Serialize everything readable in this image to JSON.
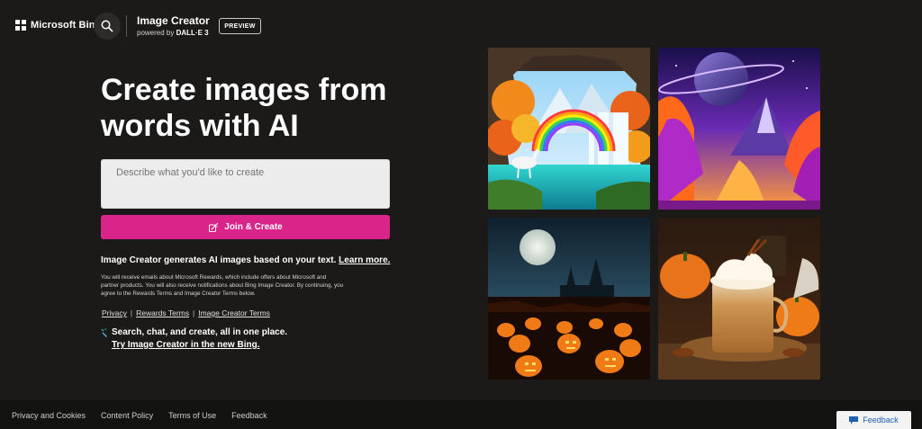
{
  "header": {
    "brand": "Microsoft Bing",
    "app_title": "Image Creator",
    "powered_prefix": "powered by",
    "powered_model": "DALL·E 3",
    "badge": "PREVIEW"
  },
  "hero": {
    "title": "Create images from words with AI",
    "prompt_placeholder": "Describe what you'd like to create",
    "join_button": "Join & Create",
    "info_text": "Image Creator generates AI images based on your text.",
    "info_link": "Learn more.",
    "fine_print": "You will receive emails about Microsoft Rewards, which include offers about Microsoft and partner products. You will also receive notifications about Bing Image Creator. By continuing, you agree to the Rewards Terms and Image Creator Terms below.",
    "legal_links": [
      "Privacy",
      "Rewards Terms",
      "Image Creator Terms"
    ],
    "legal_separator": "|",
    "promo_title": "Search, chat, and create, all in one place.",
    "promo_link": "Try Image Creator in the new Bing."
  },
  "gallery": {
    "images": [
      {
        "name": "fantasy-waterfall-unicorn"
      },
      {
        "name": "alien-planet-landscape"
      },
      {
        "name": "halloween-pumpkin-field"
      },
      {
        "name": "pumpkin-spice-latte"
      }
    ]
  },
  "footer": {
    "links": [
      "Privacy and Cookies",
      "Content Policy",
      "Terms of Use",
      "Feedback"
    ],
    "feedback_button": "Feedback"
  },
  "colors": {
    "background": "#1b1a19",
    "accent": "#d9248a",
    "footer": "#131312"
  },
  "icons": [
    "microsoft-logo-icon",
    "search-icon",
    "magic-create-icon",
    "sparkle-icon",
    "feedback-chat-icon"
  ]
}
